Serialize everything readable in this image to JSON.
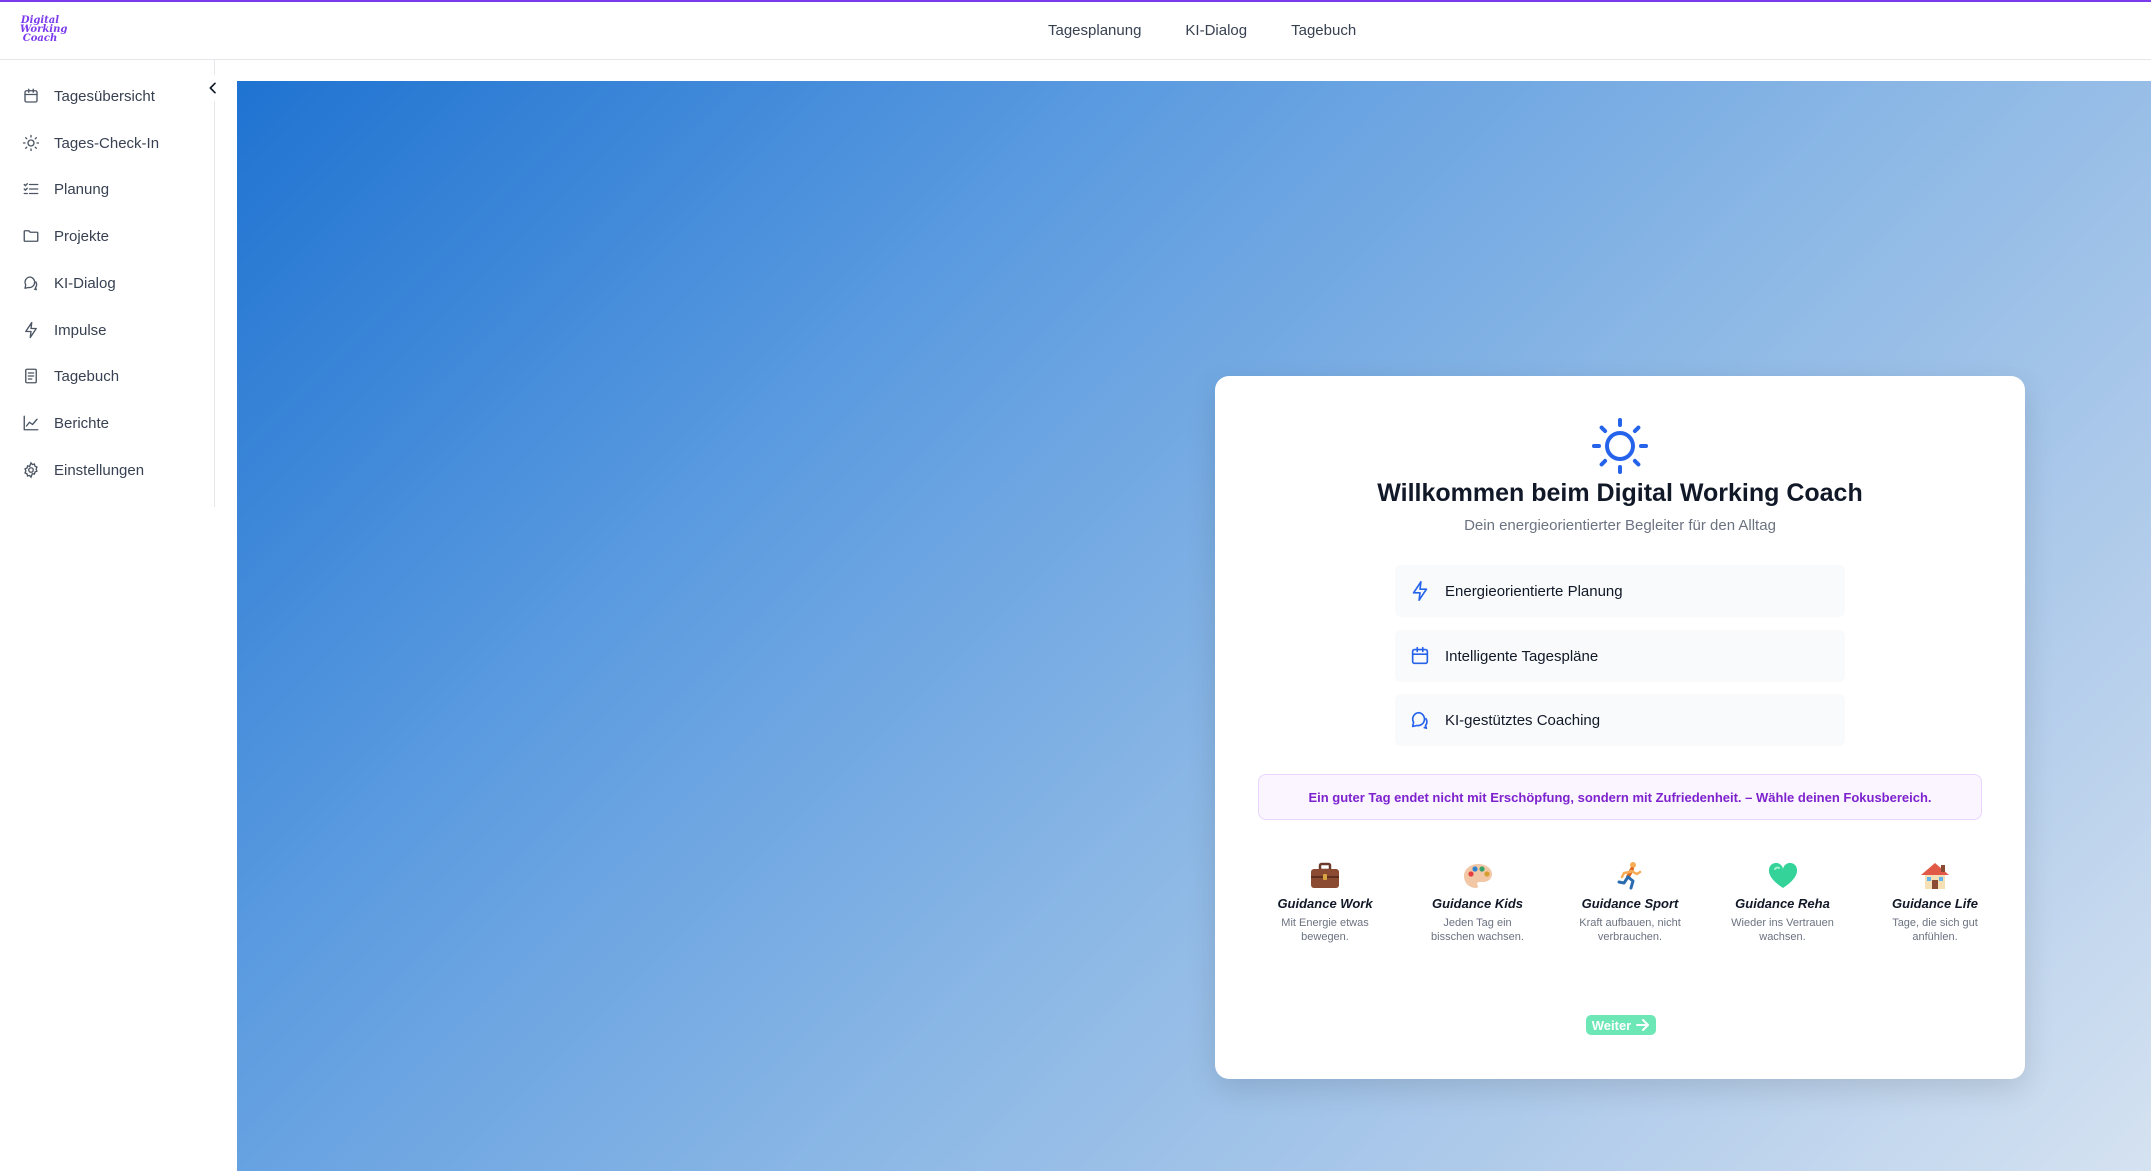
{
  "app": {
    "logo_lines": [
      "Digital",
      "Working",
      "Coach"
    ],
    "accent": "#7c3aed"
  },
  "topnav": [
    {
      "label": "Tagesplanung"
    },
    {
      "label": "KI-Dialog"
    },
    {
      "label": "Tagebuch"
    }
  ],
  "sidebar": {
    "items": [
      {
        "label": "Tagesübersicht",
        "icon": "calendar-icon"
      },
      {
        "label": "Tages-Check-In",
        "icon": "sun-icon"
      },
      {
        "label": "Planung",
        "icon": "list-checks-icon"
      },
      {
        "label": "Projekte",
        "icon": "folder-icon"
      },
      {
        "label": "KI-Dialog",
        "icon": "chat-icon"
      },
      {
        "label": "Impulse",
        "icon": "lightning-icon"
      },
      {
        "label": "Tagebuch",
        "icon": "notebook-icon"
      },
      {
        "label": "Berichte",
        "icon": "chart-line-icon"
      },
      {
        "label": "Einstellungen",
        "icon": "gear-icon"
      }
    ]
  },
  "welcome": {
    "title": "Willkommen beim Digital Working Coach",
    "subtitle": "Dein energieorientierter Begleiter für den Alltag",
    "features": [
      {
        "label": "Energieorientierte Planung",
        "icon": "lightning-icon"
      },
      {
        "label": "Intelligente Tagespläne",
        "icon": "calendar-icon"
      },
      {
        "label": "KI-gestütztes Coaching",
        "icon": "chat-icon"
      }
    ],
    "quote": "Ein guter Tag endet nicht mit Erschöpfung, sondern mit Zufriedenheit. – Wähle deinen Fokusbereich.",
    "guidance": [
      {
        "name": "Guidance Work",
        "desc_lines": [
          "Mit Energie etwas",
          "bewegen."
        ],
        "icon": "briefcase-icon"
      },
      {
        "name": "Guidance Kids",
        "desc_lines": [
          "Jeden Tag ein",
          "bisschen wachsen."
        ],
        "icon": "palette-icon"
      },
      {
        "name": "Guidance Sport",
        "desc_lines": [
          "Kraft aufbauen, nicht",
          "verbrauchen."
        ],
        "icon": "runner-icon"
      },
      {
        "name": "Guidance Reha",
        "desc_lines": [
          "Wieder ins Vertrauen",
          "wachsen."
        ],
        "icon": "heart-icon"
      },
      {
        "name": "Guidance Life",
        "desc_lines": [
          "Tage, die sich gut",
          "anfühlen."
        ],
        "icon": "house-icon"
      }
    ],
    "next_label": "Weiter",
    "primary_color": "#2563eb",
    "button_color": "#6ee7b7"
  }
}
